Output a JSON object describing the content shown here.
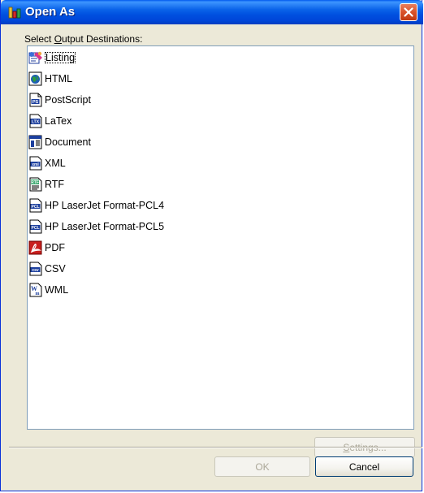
{
  "window": {
    "title": "Open As",
    "close_icon": "close-icon",
    "app_icon": "bar-chart-icon"
  },
  "label": {
    "before": "Select ",
    "accel": "O",
    "after": "utput Destinations:"
  },
  "destinations": [
    {
      "label": "Listing",
      "icon": "listing-icon",
      "selected": true
    },
    {
      "label": "HTML",
      "icon": "html-icon",
      "selected": false
    },
    {
      "label": "PostScript",
      "icon": "postscript-icon",
      "selected": false
    },
    {
      "label": "LaTex",
      "icon": "latex-icon",
      "selected": false
    },
    {
      "label": "Document",
      "icon": "document-icon",
      "selected": false
    },
    {
      "label": "XML",
      "icon": "xml-icon",
      "selected": false
    },
    {
      "label": "RTF",
      "icon": "rtf-icon",
      "selected": false
    },
    {
      "label": "HP LaserJet Format-PCL4",
      "icon": "pcl-icon",
      "selected": false
    },
    {
      "label": "HP LaserJet Format-PCL5",
      "icon": "pcl-icon",
      "selected": false
    },
    {
      "label": "PDF",
      "icon": "pdf-icon",
      "selected": false
    },
    {
      "label": "CSV",
      "icon": "csv-icon",
      "selected": false
    },
    {
      "label": "WML",
      "icon": "wml-icon",
      "selected": false
    }
  ],
  "buttons": {
    "settings": {
      "accel": "S",
      "rest": "ettings...",
      "enabled": false
    },
    "ok": {
      "label": "OK",
      "enabled": false
    },
    "cancel": {
      "label": "Cancel",
      "enabled": true
    }
  },
  "colors": {
    "titlebar": "#0a62e8",
    "dialog_bg": "#ece9d8",
    "close_button": "#d9522a",
    "list_border": "#7f9db9"
  }
}
